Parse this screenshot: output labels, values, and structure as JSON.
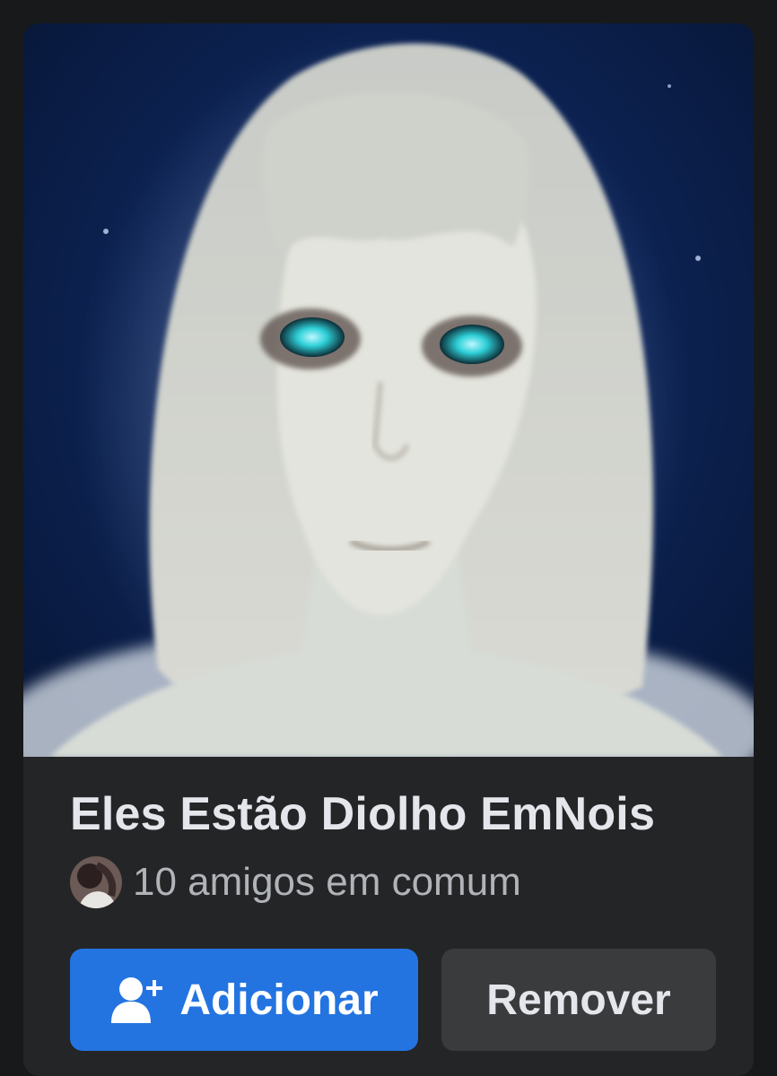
{
  "suggestion_card": {
    "photo_description_icon": "profile-photo",
    "name": "Eles Estão Diolho EmNois",
    "mutual_friends_text": "10 amigos em comum",
    "mutual_avatar_icon": "avatar-icon",
    "add_button_label": "Adicionar",
    "add_button_icon": "add-friend-icon",
    "remove_button_label": "Remover"
  },
  "colors": {
    "page_background": "#18191a",
    "card_background": "#242526",
    "primary_button": "#2374e1",
    "secondary_button": "#3a3b3c",
    "name_text": "#e4e6eb",
    "secondary_text": "#b0b3b8"
  }
}
